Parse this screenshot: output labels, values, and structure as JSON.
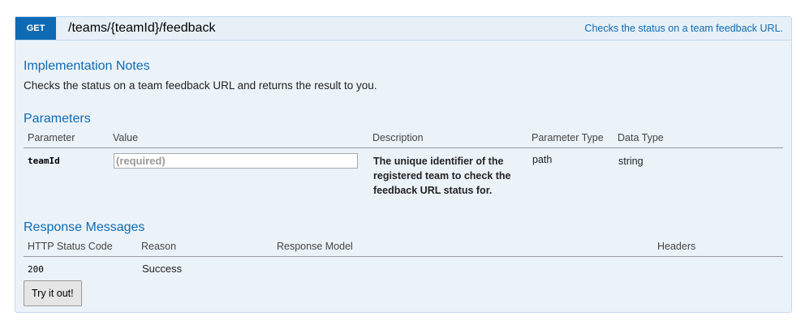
{
  "endpoint": {
    "method": "GET",
    "path": "/teams/{teamId}/feedback",
    "summary": "Checks the status on a team feedback URL."
  },
  "implementation_notes": {
    "title": "Implementation Notes",
    "text": "Checks the status on a team feedback URL and returns the result to you."
  },
  "parameters": {
    "title": "Parameters",
    "headers": {
      "parameter": "Parameter",
      "value": "Value",
      "description": "Description",
      "parameter_type": "Parameter Type",
      "data_type": "Data Type"
    },
    "rows": [
      {
        "name": "teamId",
        "placeholder": "(required)",
        "description": "The unique identifier of the registered team to check the feedback URL status for.",
        "parameter_type": "path",
        "data_type": "string"
      }
    ]
  },
  "response_messages": {
    "title": "Response Messages",
    "headers": {
      "status_code": "HTTP Status Code",
      "reason": "Reason",
      "model": "Response Model",
      "headers": "Headers"
    },
    "rows": [
      {
        "code": "200",
        "reason": "Success"
      }
    ]
  },
  "actions": {
    "try_label": "Try it out!"
  },
  "colors": {
    "method_bg": "#0f6ab4",
    "panel_bg": "#ebf3f9",
    "title": "#0f6ab4"
  }
}
